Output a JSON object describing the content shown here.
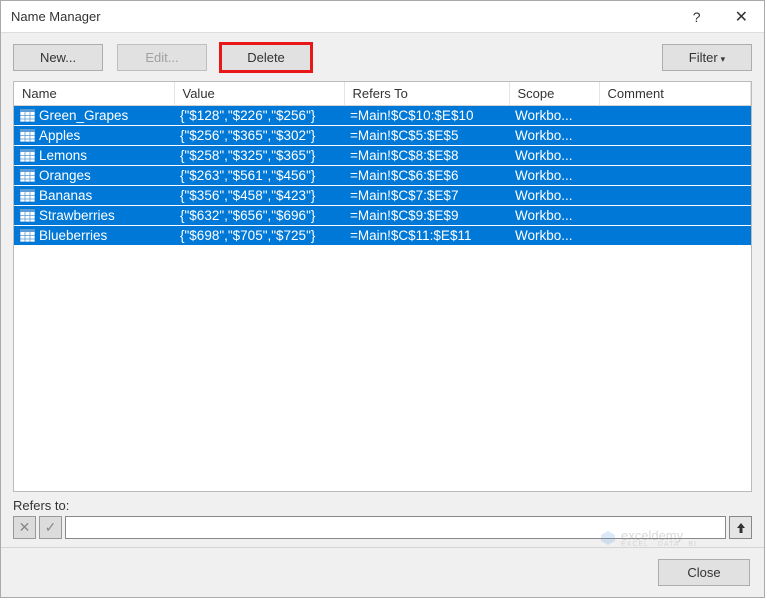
{
  "dialog": {
    "title": "Name Manager"
  },
  "toolbar": {
    "new_label": "New...",
    "edit_label": "Edit...",
    "delete_label": "Delete",
    "filter_label": "Filter"
  },
  "columns": {
    "name": "Name",
    "value": "Value",
    "refers": "Refers To",
    "scope": "Scope",
    "comment": "Comment"
  },
  "rows": [
    {
      "name": "Green_Grapes",
      "value": "{\"$128\",\"$226\",\"$256\"}",
      "refers": "=Main!$C$10:$E$10",
      "scope": "Workbo...",
      "comment": ""
    },
    {
      "name": "Apples",
      "value": "{\"$256\",\"$365\",\"$302\"}",
      "refers": "=Main!$C$5:$E$5",
      "scope": "Workbo...",
      "comment": ""
    },
    {
      "name": "Lemons",
      "value": "{\"$258\",\"$325\",\"$365\"}",
      "refers": "=Main!$C$8:$E$8",
      "scope": "Workbo...",
      "comment": ""
    },
    {
      "name": "Oranges",
      "value": "{\"$263\",\"$561\",\"$456\"}",
      "refers": "=Main!$C$6:$E$6",
      "scope": "Workbo...",
      "comment": ""
    },
    {
      "name": "Bananas",
      "value": "{\"$356\",\"$458\",\"$423\"}",
      "refers": "=Main!$C$7:$E$7",
      "scope": "Workbo...",
      "comment": ""
    },
    {
      "name": "Strawberries",
      "value": "{\"$632\",\"$656\",\"$696\"}",
      "refers": "=Main!$C$9:$E$9",
      "scope": "Workbo...",
      "comment": ""
    },
    {
      "name": "Blueberries",
      "value": "{\"$698\",\"$705\",\"$725\"}",
      "refers": "=Main!$C$11:$E$11",
      "scope": "Workbo...",
      "comment": ""
    }
  ],
  "refers_to": {
    "label": "Refers to:",
    "value": ""
  },
  "footer": {
    "close_label": "Close"
  },
  "watermark": {
    "brand": "exceldemy",
    "tagline": "EXCEL · DATA · BI"
  }
}
